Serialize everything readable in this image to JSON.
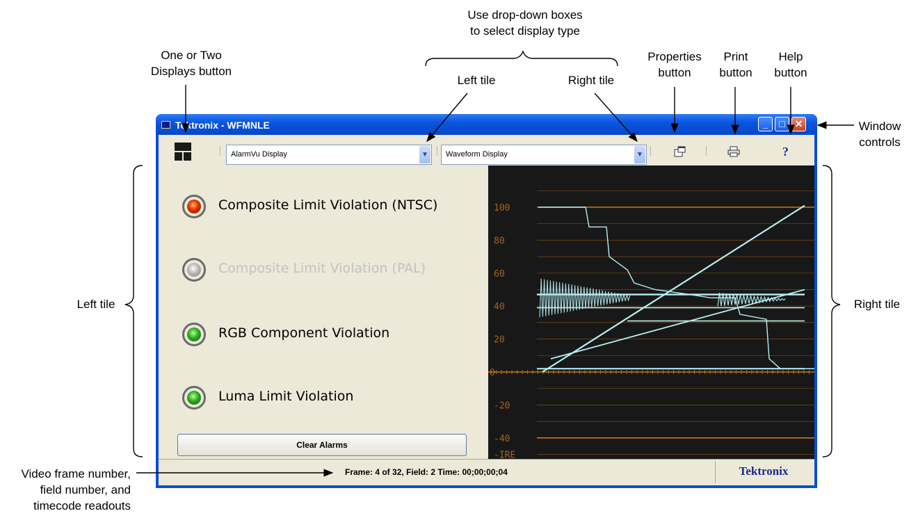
{
  "callouts": {
    "drop_down_note": "Use drop-down boxes\nto select display type",
    "one_or_two": "One or Two\nDisplays button",
    "left_tile_top": "Left tile",
    "right_tile_top": "Right tile",
    "properties": "Properties\nbutton",
    "print": "Print\nbutton",
    "help": "Help\nbutton",
    "window_controls": "Window\ncontrols",
    "left_tile_side": "Left tile",
    "right_tile_side": "Right tile",
    "frame_readout": "Video frame number,\nfield number, and\ntimecode readouts"
  },
  "window": {
    "title": "Tektronix - WFMNLE",
    "left_display": "AlarmVu  Display",
    "right_display": "Waveform Display"
  },
  "alarms": [
    {
      "label": "Composite Limit Violation (NTSC)",
      "state": "red"
    },
    {
      "label": "Composite Limit Violation (PAL)",
      "state": "gray"
    },
    {
      "label": "RGB Component Violation",
      "state": "green"
    },
    {
      "label": "Luma Limit Violation",
      "state": "green"
    }
  ],
  "clear_button": "Clear Alarms",
  "waveform": {
    "scale_labels": [
      "100",
      "80",
      "60",
      "40",
      "20",
      "0",
      "-20",
      "-40",
      "-IRE"
    ],
    "trace_color": "#b8f0f4",
    "graticule_color": "#c8781a"
  },
  "status": {
    "readout": "Frame: 4 of 32,  Field: 2   Time: 00;00;00;04",
    "brand": "Tektronix"
  },
  "icons": {
    "layout": "two-displays-icon",
    "properties": "properties-icon",
    "print": "printer-icon",
    "help": "?"
  }
}
